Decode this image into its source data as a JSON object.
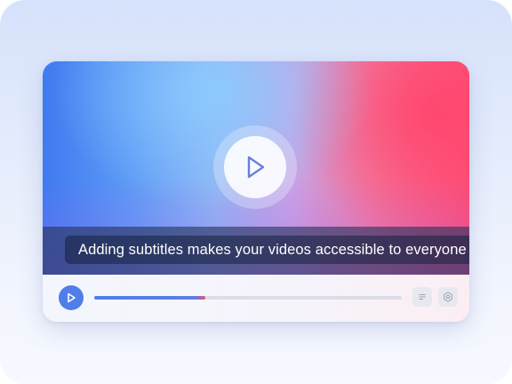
{
  "subtitle": {
    "text": "Adding subtitles makes your videos accessible to everyone"
  },
  "player": {
    "progress": 0.36
  },
  "icons": {
    "center_play": "play-outline-icon",
    "control_play": "play-outline-icon",
    "subtitles": "subtitles-lines-icon",
    "settings": "gear-icon"
  },
  "colors": {
    "accent": "#4f7eea",
    "progress_end": "#e45577",
    "track": "#dcdde9"
  }
}
